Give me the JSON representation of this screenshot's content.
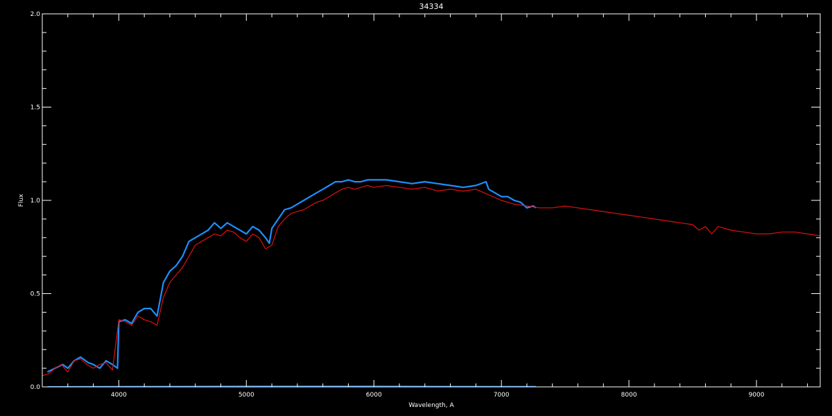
{
  "chart_data": {
    "type": "line",
    "title": "34334",
    "xlabel": "Wavelength, A",
    "ylabel": "Flux",
    "xlim": [
      3400,
      9500
    ],
    "ylim": [
      0.0,
      2.0
    ],
    "grid": false,
    "x_ticks": [
      4000,
      5000,
      6000,
      7000,
      8000,
      9000
    ],
    "x_tick_labels": [
      "4000",
      "5000",
      "6000",
      "7000",
      "8000",
      "9000"
    ],
    "y_ticks": [
      0.0,
      0.5,
      1.0,
      1.5,
      2.0
    ],
    "y_tick_labels": [
      "0.0",
      "0.5",
      "1.0",
      "1.5",
      "2.0"
    ],
    "colors": {
      "background": "#000000",
      "axes": "#ffffff",
      "observed": "#1e8fff",
      "model": "#e01010",
      "error": "#ffffff"
    },
    "series": [
      {
        "color": "#1e8fff",
        "x": [
          3440,
          3500,
          3560,
          3600,
          3650,
          3700,
          3760,
          3800,
          3850,
          3900,
          3950,
          3990,
          4000,
          4050,
          4100,
          4150,
          4200,
          4250,
          4300,
          4350,
          4400,
          4450,
          4500,
          4550,
          4600,
          4650,
          4700,
          4750,
          4800,
          4850,
          4900,
          4950,
          5000,
          5050,
          5100,
          5150,
          5180,
          5200,
          5250,
          5300,
          5350,
          5400,
          5450,
          5500,
          5550,
          5600,
          5650,
          5700,
          5750,
          5800,
          5850,
          5900,
          5950,
          6000,
          6100,
          6200,
          6300,
          6400,
          6500,
          6600,
          6700,
          6800,
          6880,
          6900,
          6950,
          7000,
          7050,
          7100,
          7150,
          7200,
          7250,
          7270
        ],
        "y": [
          0.08,
          0.1,
          0.12,
          0.1,
          0.14,
          0.16,
          0.13,
          0.12,
          0.1,
          0.14,
          0.12,
          0.1,
          0.35,
          0.36,
          0.34,
          0.4,
          0.42,
          0.42,
          0.38,
          0.56,
          0.62,
          0.65,
          0.7,
          0.78,
          0.8,
          0.82,
          0.84,
          0.88,
          0.85,
          0.88,
          0.86,
          0.84,
          0.82,
          0.86,
          0.84,
          0.8,
          0.77,
          0.85,
          0.9,
          0.95,
          0.96,
          0.98,
          1.0,
          1.02,
          1.04,
          1.06,
          1.08,
          1.1,
          1.1,
          1.11,
          1.1,
          1.1,
          1.11,
          1.11,
          1.11,
          1.1,
          1.09,
          1.1,
          1.09,
          1.08,
          1.07,
          1.08,
          1.1,
          1.06,
          1.04,
          1.02,
          1.02,
          1.0,
          0.99,
          0.96,
          0.97,
          0.96
        ]
      },
      {
        "color": "#e01010",
        "x": [
          3400,
          3450,
          3500,
          3550,
          3600,
          3650,
          3700,
          3750,
          3800,
          3850,
          3900,
          3950,
          4000,
          4050,
          4100,
          4150,
          4200,
          4250,
          4300,
          4350,
          4400,
          4450,
          4500,
          4550,
          4600,
          4650,
          4700,
          4750,
          4800,
          4850,
          4900,
          4950,
          5000,
          5050,
          5100,
          5150,
          5200,
          5250,
          5300,
          5350,
          5400,
          5450,
          5500,
          5550,
          5600,
          5650,
          5700,
          5750,
          5800,
          5850,
          5900,
          5950,
          6000,
          6100,
          6200,
          6300,
          6400,
          6500,
          6600,
          6700,
          6800,
          6900,
          7000,
          7100,
          7200,
          7300,
          7400,
          7500,
          7600,
          7700,
          7800,
          7900,
          8000,
          8100,
          8200,
          8300,
          8400,
          8500,
          8550,
          8600,
          8650,
          8700,
          8800,
          8900,
          9000,
          9100,
          9200,
          9300,
          9400,
          9500
        ],
        "y": [
          0.06,
          0.07,
          0.1,
          0.12,
          0.08,
          0.14,
          0.15,
          0.12,
          0.1,
          0.12,
          0.13,
          0.09,
          0.36,
          0.35,
          0.33,
          0.38,
          0.36,
          0.35,
          0.33,
          0.48,
          0.56,
          0.6,
          0.64,
          0.7,
          0.76,
          0.78,
          0.8,
          0.82,
          0.81,
          0.84,
          0.83,
          0.8,
          0.78,
          0.82,
          0.8,
          0.74,
          0.76,
          0.86,
          0.9,
          0.93,
          0.94,
          0.95,
          0.97,
          0.99,
          1.0,
          1.02,
          1.04,
          1.06,
          1.07,
          1.06,
          1.07,
          1.08,
          1.07,
          1.08,
          1.07,
          1.06,
          1.07,
          1.05,
          1.06,
          1.05,
          1.06,
          1.03,
          1.0,
          0.98,
          0.97,
          0.96,
          0.96,
          0.97,
          0.96,
          0.95,
          0.94,
          0.93,
          0.92,
          0.91,
          0.9,
          0.89,
          0.88,
          0.87,
          0.84,
          0.86,
          0.82,
          0.86,
          0.84,
          0.83,
          0.82,
          0.82,
          0.83,
          0.83,
          0.82,
          0.81
        ]
      },
      {
        "color": "#1e8fff",
        "x": [
          3440,
          4000,
          5000,
          6000,
          7000,
          7270
        ],
        "y": [
          0.002,
          0.003,
          0.004,
          0.004,
          0.003,
          0.003
        ]
      }
    ]
  }
}
